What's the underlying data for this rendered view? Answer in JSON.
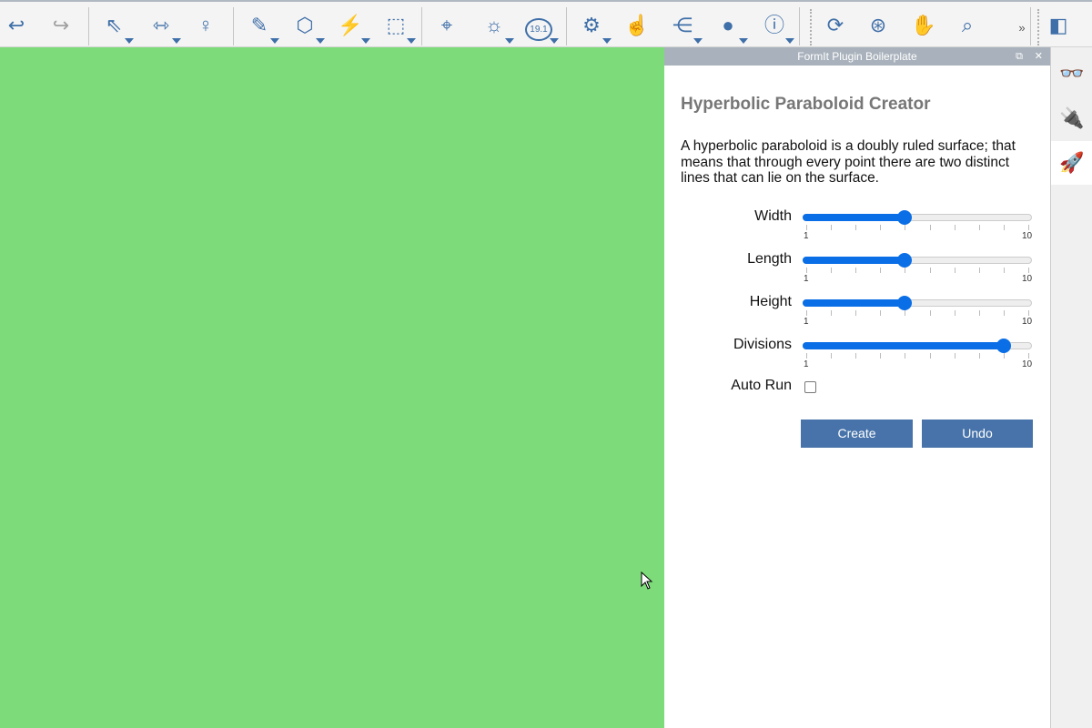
{
  "toolbar": {
    "items": [
      {
        "name": "undo",
        "glyph": "↩"
      },
      {
        "name": "redo",
        "glyph": "↪"
      },
      {
        "name": "select",
        "glyph": "⇖"
      },
      {
        "name": "measure",
        "glyph": "⇿"
      },
      {
        "name": "probe",
        "glyph": "♀"
      },
      {
        "name": "sketch",
        "glyph": "✎"
      },
      {
        "name": "cube",
        "glyph": "⬡"
      },
      {
        "name": "extrude",
        "glyph": "⚡"
      },
      {
        "name": "group",
        "glyph": "⬚"
      },
      {
        "name": "location",
        "glyph": "⌖"
      },
      {
        "name": "sun",
        "glyph": "☼"
      },
      {
        "name": "version",
        "glyph": "19.1"
      },
      {
        "name": "settings",
        "glyph": "⚙"
      },
      {
        "name": "gesture",
        "glyph": "☝"
      },
      {
        "name": "share",
        "glyph": "⋲"
      },
      {
        "name": "user",
        "glyph": "●"
      },
      {
        "name": "info",
        "glyph": "ⓘ"
      },
      {
        "name": "orbit",
        "glyph": "⟳"
      },
      {
        "name": "look",
        "glyph": "⊛"
      },
      {
        "name": "pan",
        "glyph": "✋"
      },
      {
        "name": "zoom",
        "glyph": "⌕"
      },
      {
        "name": "more",
        "glyph": "»"
      },
      {
        "name": "view",
        "glyph": "◧"
      }
    ]
  },
  "panel": {
    "window_title": "FormIt Plugin Boilerplate",
    "restore_glyph": "⧉",
    "close_glyph": "✕",
    "heading": "Hyperbolic Paraboloid Creator",
    "description": "A hyperbolic paraboloid is a doubly ruled surface; that means that through every point there are two distinct lines that can lie on the surface.",
    "sliders": [
      {
        "label": "Width",
        "min": 1,
        "max": 10,
        "value": 5,
        "min_label": "1",
        "max_label": "10"
      },
      {
        "label": "Length",
        "min": 1,
        "max": 10,
        "value": 5,
        "min_label": "1",
        "max_label": "10"
      },
      {
        "label": "Height",
        "min": 1,
        "max": 10,
        "value": 5,
        "min_label": "1",
        "max_label": "10"
      },
      {
        "label": "Divisions",
        "min": 1,
        "max": 10,
        "value": 9,
        "min_label": "1",
        "max_label": "10"
      }
    ],
    "auto_run": {
      "label": "Auto Run",
      "checked": false
    },
    "create_label": "Create",
    "undo_label": "Undo"
  },
  "side_tabs": [
    {
      "name": "glasses-icon",
      "glyph": "👓"
    },
    {
      "name": "plugin-icon",
      "glyph": "🔌"
    },
    {
      "name": "rocket-icon",
      "glyph": "🚀",
      "active": true
    }
  ],
  "colors": {
    "viewport": "#7ddb7a",
    "accent": "#0a6ee6",
    "button": "#4773aa",
    "titlebar": "#a9b2bc"
  }
}
